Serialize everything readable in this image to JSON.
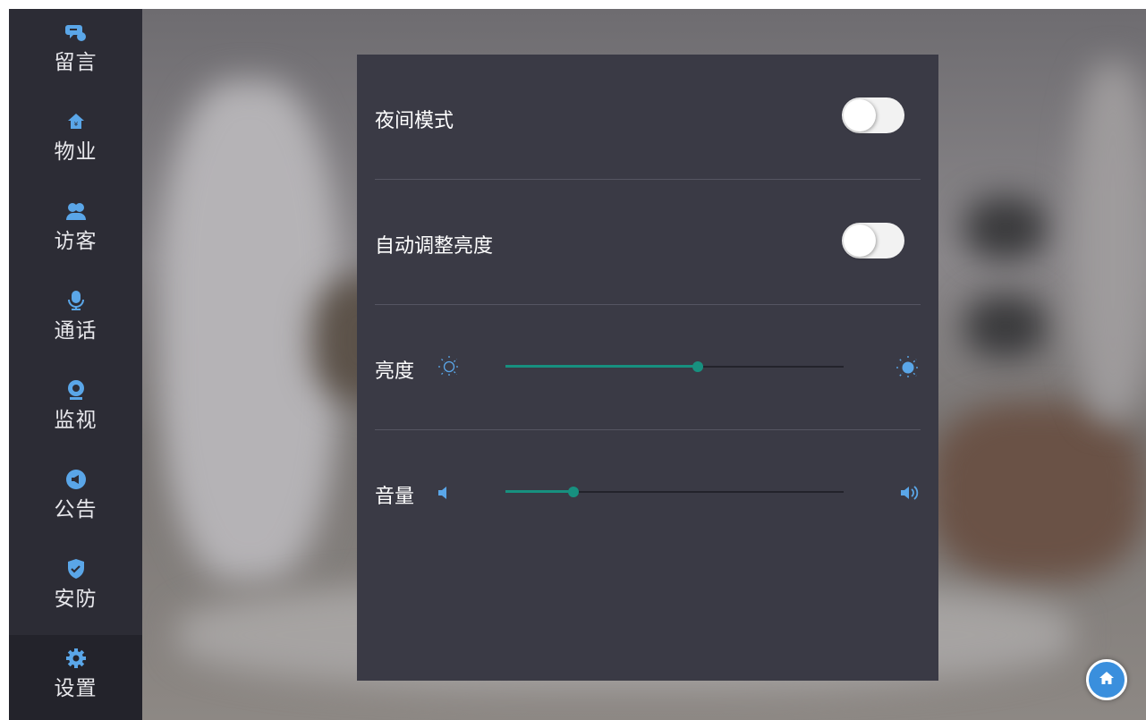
{
  "sidebar": {
    "items": [
      {
        "label": "留言",
        "icon": "message-icon"
      },
      {
        "label": "物业",
        "icon": "property-home-icon"
      },
      {
        "label": "访客",
        "icon": "visitors-icon"
      },
      {
        "label": "通话",
        "icon": "microphone-icon"
      },
      {
        "label": "监视",
        "icon": "camera-icon"
      },
      {
        "label": "公告",
        "icon": "megaphone-icon"
      },
      {
        "label": "安防",
        "icon": "shield-icon"
      },
      {
        "label": "设置",
        "icon": "gear-icon"
      }
    ],
    "active_index": 7
  },
  "settings": {
    "night_mode": {
      "label": "夜间模式",
      "enabled": false
    },
    "auto_brightness": {
      "label": "自动调整亮度",
      "enabled": false
    },
    "brightness": {
      "label": "亮度",
      "value_fraction": 0.57,
      "min_icon": "sun-outline-icon",
      "max_icon": "sun-filled-icon"
    },
    "volume": {
      "label": "音量",
      "value_fraction": 0.2,
      "min_icon": "speaker-low-icon",
      "max_icon": "speaker-high-icon"
    }
  },
  "home_button": {
    "icon": "home-icon"
  },
  "colors": {
    "accent": "#17907f",
    "icon_blue": "#5aa6e8",
    "sidebar_bg": "#2c2c35",
    "panel_bg": "#3a3a45"
  }
}
